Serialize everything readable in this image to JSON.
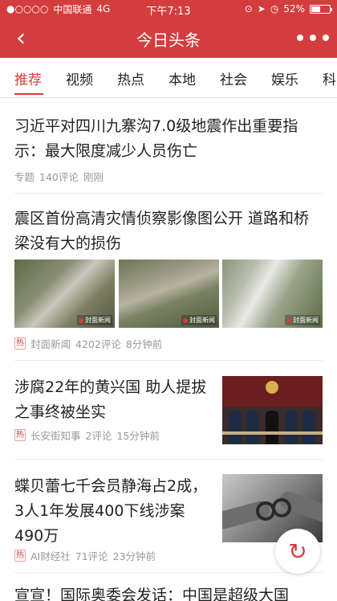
{
  "status_bar": {
    "signal": "●○○○○",
    "carrier": "中国联通",
    "network": "4G",
    "time": "下午7:13",
    "battery_text": "52%",
    "battery_level": 0.52
  },
  "header": {
    "back_icon": "‹",
    "title": "今日头条",
    "more_icon": "more-dots-icon"
  },
  "tabs": [
    {
      "label": "推荐"
    },
    {
      "label": "视频"
    },
    {
      "label": "热点"
    },
    {
      "label": "本地"
    },
    {
      "label": "社会"
    },
    {
      "label": "娱乐"
    },
    {
      "label": "科"
    }
  ],
  "active_tab_index": 0,
  "articles": [
    {
      "title": "习近平对四川九寨沟7.0级地震作出重要指示：最大限度减少人员伤亡",
      "meta": {
        "hot": "",
        "source": "专题",
        "comments": "140评论",
        "time": "刚刚"
      }
    },
    {
      "title": "震区首份高清灾情侦察影像图公开 道路和桥梁没有大的损伤",
      "image_watermark": "封面新闻",
      "meta": {
        "hot": "热",
        "source": "封面新闻",
        "comments": "4202评论",
        "time": "8分钟前"
      }
    },
    {
      "title": "涉腐22年的黄兴国 助人提拔之事终被坐实",
      "meta": {
        "hot": "热",
        "source": "长安街知事",
        "comments": "2评论",
        "time": "15分钟前"
      }
    },
    {
      "title": "蝶贝蕾七千会员静海占2成，3人1年发展400下线涉案490万",
      "meta": {
        "hot": "热",
        "source": "AI财经社",
        "comments": "71评论",
        "time": "23分钟前"
      }
    },
    {
      "title": "宣宣！国际奥委会发话：中国是超级大国"
    }
  ],
  "refresh_icon": "↻",
  "colors": {
    "brand": "#d43d3d",
    "meta_gray": "#999999"
  }
}
